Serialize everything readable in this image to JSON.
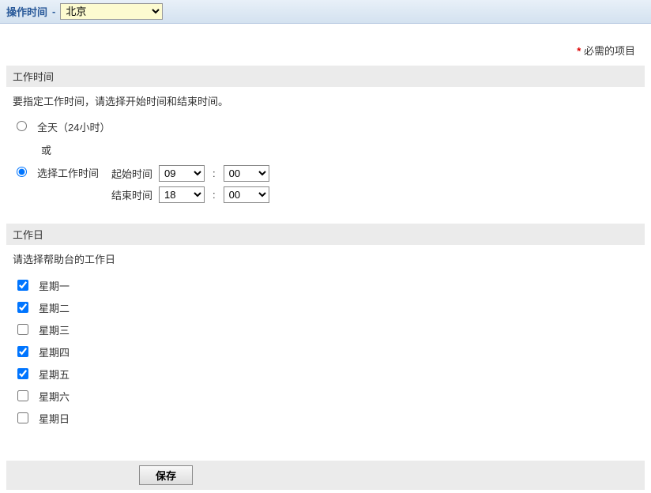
{
  "header": {
    "title": "操作时间",
    "separator": "-",
    "site_selected": "北京"
  },
  "required_note": "必需的项目",
  "sections": {
    "work_time": {
      "header": "工作时间",
      "instruction": "要指定工作时间，请选择开始时间和结束时间。",
      "option_all_day": "全天（24小时）",
      "or_text": "或",
      "option_select_time": "选择工作时间",
      "start_label": "起始时间",
      "end_label": "结束时间",
      "start_hour": "09",
      "start_minute": "00",
      "end_hour": "18",
      "end_minute": "00"
    },
    "work_days": {
      "header": "工作日",
      "instruction": "请选择帮助台的工作日",
      "days": [
        {
          "label": "星期一",
          "checked": true
        },
        {
          "label": "星期二",
          "checked": true
        },
        {
          "label": "星期三",
          "checked": false
        },
        {
          "label": "星期四",
          "checked": true
        },
        {
          "label": "星期五",
          "checked": true
        },
        {
          "label": "星期六",
          "checked": false
        },
        {
          "label": "星期日",
          "checked": false
        }
      ]
    }
  },
  "footer": {
    "save_label": "保存"
  }
}
